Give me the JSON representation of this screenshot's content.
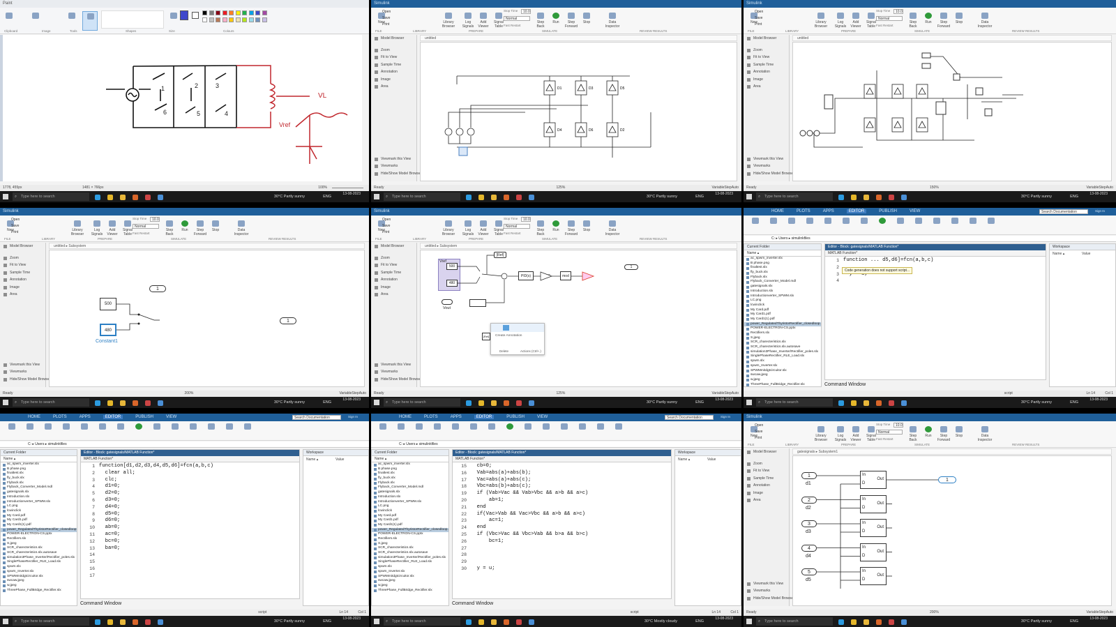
{
  "taskbar": {
    "search_placeholder": "Type here to search",
    "weather_sunny": "30°C  Partly sunny",
    "weather_cloudy": "30°C  Mostly cloudy",
    "lang": "ENG",
    "date": "13-08-2023"
  },
  "paint": {
    "strip": "Paint",
    "groups": [
      "Clipboard",
      "Image",
      "Tools",
      "Shapes",
      "Size",
      "Colours"
    ],
    "status_pos": "1778, 455px",
    "status_size": "1481 × 766px",
    "status_zoom": "100%",
    "palette": [
      "#000000",
      "#7f7f7f",
      "#880015",
      "#ed1c24",
      "#ff7f27",
      "#fff200",
      "#22b14c",
      "#00a2e8",
      "#3f48cc",
      "#a349a4",
      "#ffffff",
      "#c3c3c3",
      "#b97a57",
      "#ffaec9",
      "#ffc90e",
      "#efe4b0",
      "#b5e61d",
      "#99d9ea",
      "#7092be",
      "#c8bfe7"
    ],
    "sketch_labels": {
      "n1": "1",
      "n2": "2",
      "n3": "3",
      "n4": "4",
      "n5": "5",
      "n6": "6",
      "vl": "VL",
      "vref": "Vref"
    }
  },
  "simulink": {
    "strip": "Simulink",
    "stop_time_label": "Stop Time",
    "stop_time": "10.0",
    "solver": "Normal",
    "fast_restart": "Fast Restart",
    "groups": [
      "FILE",
      "LIBRARY",
      "PREPARE",
      "SIMULATE",
      "REVIEW RESULTS"
    ],
    "buttons": [
      "New",
      "Open",
      "Save",
      "Print",
      "Library Browser",
      "Log Signals",
      "Add Viewer",
      "Signal Table",
      "Step Back",
      "Run",
      "Step Forward",
      "Stop",
      "Data Inspector"
    ],
    "sidebar": [
      "Model Browser",
      "Zoom",
      "Fit to View",
      "Sample Time",
      "Annotation",
      "Image",
      "Area"
    ],
    "sidebar_bottom": [
      "Viewmark this View",
      "Viewmarks",
      "Hide/Show Model Browser"
    ],
    "ready": "Ready",
    "zoom1": "125%",
    "zoom2": "150%",
    "zoom3": "200%",
    "solver_status": "VariableStepAuto",
    "crumb_untitled": "untitled",
    "crumb_sub": "untitled ▸ Subsystem",
    "crumb_gates": "gatesignals ▸ Subsystem1"
  },
  "rectifier": {
    "diodes": [
      "D1",
      "D3",
      "D5",
      "D4",
      "D6",
      "D2"
    ]
  },
  "subsystem": {
    "const_500": "500",
    "const_480": "480",
    "const_name": "Constant1",
    "outport": "1",
    "goto_tag": "1"
  },
  "control": {
    "vref": "Vref",
    "c500": "500",
    "c480": "480",
    "ref": "[Ref]",
    "pid": "PID(s)",
    "gain": "1/360",
    "mux": "mod",
    "tooltip": "Create Annotation",
    "tt_a": "Delete",
    "tt_b": "Actions (Ctrl+.)",
    "vout": "Vout",
    "out1": "1",
    "sat": "[Ref]"
  },
  "matlab": {
    "tabs": [
      "HOME",
      "PLOTS",
      "APPS",
      "EDITOR",
      "PUBLISH",
      "VIEW"
    ],
    "search_doc": "Search Documentation",
    "signin": "Sign In",
    "path": "C: ▸ Users ▸ simulinkfiles",
    "current_folder": "Current Folder",
    "name_col": "Name ▴",
    "workspace": "Workspace",
    "ws_name": "Name ▴",
    "ws_value": "Value",
    "editor_title": "Editor - Block: gatesignals/MATLAB Function*",
    "editor_tab": "MATLAB Function*",
    "command_window": "Command Window",
    "tooltip": "Code generation does not support script...",
    "script": "script",
    "ln": "Ln 14",
    "col": "Col 1",
    "files": [
      "ac_spwm_inverter.slx",
      "B phase.png",
      "finaltest.slx",
      "fly_buck.slx",
      "Flyback.slx",
      "Flyback_Converter_Model.mdl",
      "gatesignals.slx",
      "Introduction.slx",
      "Introductionverter_SPWM.slx",
      "LC.png",
      "lcwinclick",
      "My Card.pdf",
      "My Card1.pdf",
      "My Card1(1).pdf",
      "power_RegulatedThyristorRectifier_closedloop.slx",
      "POWER-ELECTRON-CS.pptx",
      "Rectifiers.slx",
      "S.jpeg",
      "SCR_charecteristics.slx",
      "SCR_charecteristics.slx.autosave",
      "simulation3Phase_Inverter/Rectifier_poles.slx",
      "SinglePhaseRectifier_RLE_Load.slx",
      "spwm.slx",
      "spwm_Inverter.slx",
      "SPWMmitdgtcircuitor.slx",
      "swcaw.jpeg",
      "w.jpeg",
      "ThreePhase_FullBridge_Rectifier.slx"
    ],
    "code_func": [
      "function[d1,d2,d3,d4,d5,d6]=fcn(a,b,c)",
      "  clear all;",
      "  clc;",
      "  d1=0;",
      "  d2=0;",
      "  d3=0;",
      "  d4=0;",
      "  d5=0;",
      "  d6=0;",
      "  ab=0;",
      "  ac=0;",
      "  bc=0;",
      "  ba=0;",
      "",
      "",
      "",
      ""
    ],
    "code_abs": [
      "  cb=0;",
      "  Vab=abs(a)+abs(b);",
      "  Vac=abs(a)+abs(c);",
      "  Vbc=abs(b)+abs(c);",
      "  if (Vab>Vac && Vab>Vbc && a>b && a>c)",
      "      ab=1;",
      "  end",
      "  if(Vac>Vab && Vac>Vbc && a>b && a>c)",
      "      ac=1;",
      "  end",
      "  if (Vbc>Vac && Vbc>Vab && b>a && b>c)",
      "      bc=1;",
      "",
      "",
      "",
      "  y = u;"
    ],
    "code_short": [
      "function ... d5,d6]=fcn(a,b,c)",
      "",
      "  y = u;",
      ""
    ]
  },
  "gates": {
    "ports": [
      "1",
      "2",
      "3",
      "4",
      "5"
    ],
    "labels": [
      "d1",
      "d2",
      "d3",
      "d4",
      "d5"
    ],
    "block_in": "In",
    "block_d": "D",
    "block_out": "Out",
    "out1": "1"
  }
}
